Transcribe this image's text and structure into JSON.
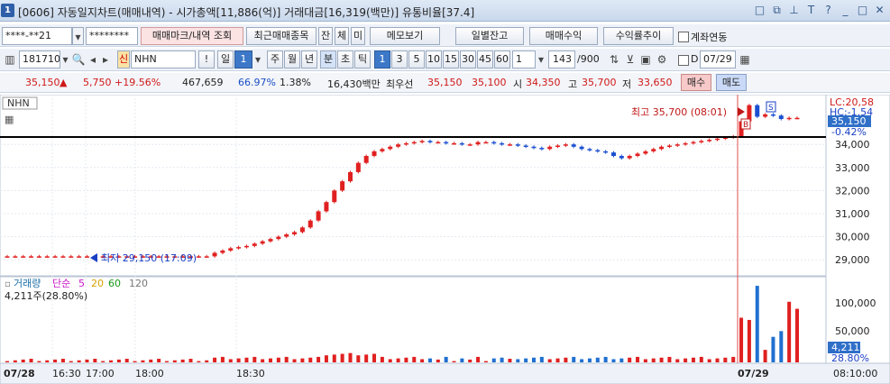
{
  "window": {
    "num": "1",
    "title": "[0606] 자동일지차트(매매내역) - 시가총액[11,886(억)] 거래대금[16,319(백만)] 유통비율[37.4]",
    "icons": [
      "restore-icon",
      "copy-icon",
      "pin-icon",
      "text-icon",
      "help-icon",
      "minimize-icon",
      "maximize-icon",
      "close-icon"
    ]
  },
  "toolbar1": {
    "account": "****-**21",
    "password": "********",
    "buttons": [
      "매매마크/내역 조회",
      "최근매매종목",
      "잔",
      "체",
      "미",
      "메모보기",
      "일별잔고",
      "매매수익",
      "수익률추이"
    ],
    "link_label": "계좌연동"
  },
  "toolbar2": {
    "code": "181710",
    "badge": "신",
    "name": "NHN",
    "excl": "!",
    "period_label": "일",
    "period_value": "1",
    "periods": [
      "주",
      "월",
      "년",
      "분",
      "초",
      "틱"
    ],
    "intervals": [
      "1",
      "3",
      "5",
      "10",
      "15",
      "30",
      "45",
      "60"
    ],
    "interval_value": "1",
    "count": "143",
    "count_total": "/900",
    "date_check_label": "D",
    "date": "07/29"
  },
  "quote": {
    "price": "35,150",
    "arrow": "▲",
    "change": "5,750",
    "change_pct": "+19.56%",
    "volume": "467,659",
    "vol_ratio": "66.97%",
    "turnover": "1.38%",
    "amount": "16,430백만",
    "best_bid_label": "최우선",
    "ask": "35,150",
    "bid": "35,100",
    "open_label": "시",
    "open": "34,350",
    "high_label": "고",
    "high": "35,700",
    "low_label": "저",
    "low": "33,650",
    "buy_label": "매수",
    "sell_label": "매도"
  },
  "chart": {
    "symbol": "NHN",
    "high_annot": "최고 35,700 (08:01)",
    "low_annot": "최저 29,150 (17:09)",
    "lc_label": "LC:20,58",
    "hc_label": "HC:-1.54",
    "price_tag": "35,150",
    "pct_tag": "-0.42%",
    "y_ticks": [
      "34,000",
      "33,000",
      "32,000",
      "31,000",
      "30,000",
      "29,000"
    ],
    "x_ticks": [
      "07/28",
      "16:30",
      "17:00",
      "18:00",
      "18:30",
      "07/29",
      "08:10:00"
    ],
    "volume_legend": [
      "거래량",
      "단순",
      "5",
      "20",
      "60",
      "120"
    ],
    "volume_info": "4,211주(28.80%)",
    "vol_y_ticks": [
      "100,000",
      "50,000"
    ],
    "vol_tag": "4,211",
    "vol_pct_tag": "28.80%",
    "buy_marker": "B",
    "sell_marker": "S"
  },
  "chart_data": {
    "type": "candlestick",
    "ylim": [
      28500,
      36000
    ],
    "price_points": [
      29150,
      29150,
      29150,
      29150,
      29150,
      29150,
      29150,
      29150,
      29150,
      29150,
      29150,
      29150,
      29150,
      29150,
      29150,
      29150,
      29150,
      29150,
      29150,
      29150,
      29150,
      29150,
      29150,
      29150,
      29150,
      29150,
      29300,
      29400,
      29500,
      29550,
      29600,
      29700,
      29800,
      29900,
      30000,
      30100,
      30200,
      30400,
      30700,
      31100,
      31500,
      32000,
      32400,
      32800,
      33200,
      33500,
      33700,
      33800,
      33900,
      34000,
      34050,
      34100,
      34150,
      34100,
      34100,
      34050,
      34050,
      34000,
      34000,
      34100,
      34100,
      34050,
      34000,
      34000,
      33950,
      33900,
      33850,
      33800,
      33900,
      33950,
      34000,
      33900,
      33800,
      33750,
      33700,
      33650,
      33500,
      33400,
      33500,
      33600,
      33700,
      33800,
      33900,
      33950,
      34000,
      34050,
      34100,
      34150,
      34200,
      34250,
      34300,
      34350,
      35000,
      35700,
      35200,
      35300,
      35250,
      35100,
      35150,
      35150
    ],
    "volume_ylim": [
      0,
      130000
    ],
    "volume_peaks": [
      120000,
      95000,
      70000,
      40000,
      28000
    ]
  }
}
